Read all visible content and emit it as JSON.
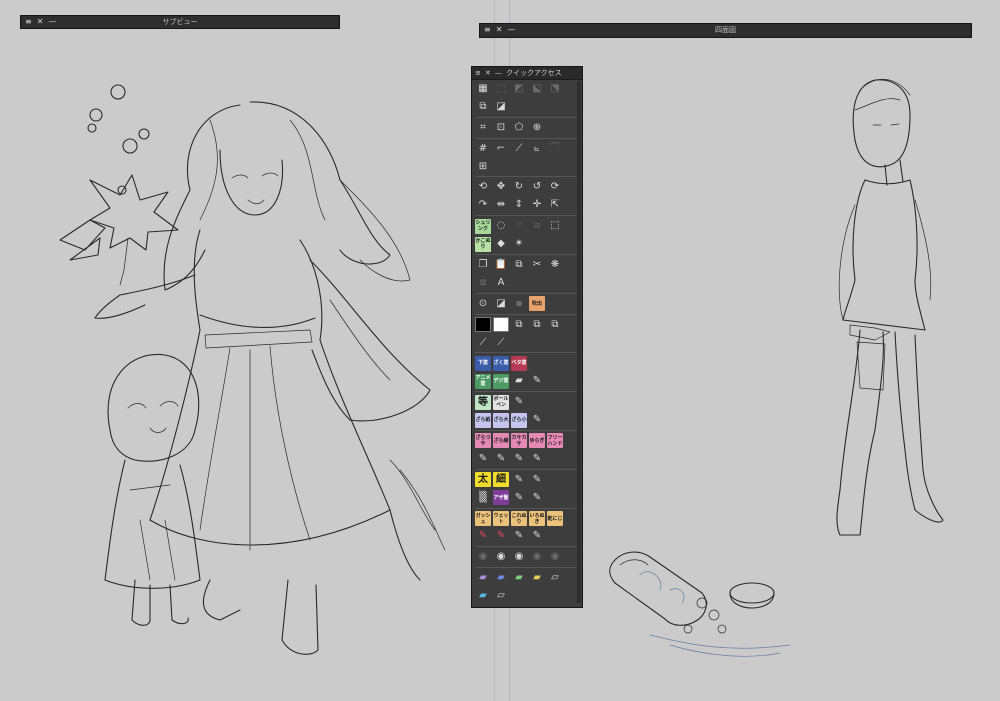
{
  "subview": {
    "title": "サブビュー",
    "close": "✕",
    "menu": "≡",
    "min": "—"
  },
  "threeview": {
    "title": "四面図",
    "close": "✕",
    "menu": "≡",
    "min": "—"
  },
  "quick_access": {
    "title": "クイックアクセス",
    "close": "✕",
    "menu": "≡",
    "min": "—",
    "rows": [
      [
        {
          "n": "select-all-icon",
          "g": "▦"
        },
        {
          "n": "deselect-icon",
          "g": "⬚",
          "d": true
        },
        {
          "n": "invert-icon",
          "g": "◩",
          "d": true
        },
        {
          "n": "expand-icon",
          "g": "⬕",
          "d": true
        },
        {
          "n": "shrink-icon",
          "g": "⬔",
          "d": true
        }
      ],
      [
        {
          "n": "new-layer-icon",
          "g": "⧉"
        },
        {
          "n": "layer-mask-icon",
          "g": "◪"
        }
      ],
      [
        {
          "n": "crop-icon",
          "g": "⌗",
          "sep": true
        },
        {
          "n": "free-transform-icon",
          "g": "⊡"
        },
        {
          "n": "distort-icon",
          "g": "⬠"
        },
        {
          "n": "mesh-icon",
          "g": "⊕"
        }
      ],
      [
        {
          "n": "grid-icon",
          "g": "#",
          "sep": true
        },
        {
          "n": "ruler-icon",
          "g": "⌐"
        },
        {
          "n": "pen-ruler-icon",
          "g": "⟋"
        },
        {
          "n": "linear-ruler-icon",
          "g": "⦜"
        },
        {
          "n": "curve-ruler-icon",
          "g": "⌒",
          "d": true
        }
      ],
      [
        {
          "n": "perspective-icon",
          "g": "⊞"
        }
      ],
      [
        {
          "n": "rotate-left-icon",
          "g": "⟲",
          "sep": true
        },
        {
          "n": "move-icon",
          "g": "✥"
        },
        {
          "n": "rotate-view-icon",
          "g": "↻"
        },
        {
          "n": "rotate-ccw-icon",
          "g": "↺"
        },
        {
          "n": "rotate-reset-icon",
          "g": "⟳"
        }
      ],
      [
        {
          "n": "rotate-right-icon",
          "g": "↷"
        },
        {
          "n": "flip-h-icon",
          "g": "⇹"
        },
        {
          "n": "flip-v-icon",
          "g": "⇕"
        },
        {
          "n": "pan-icon",
          "g": "✛"
        },
        {
          "n": "select-arrow-icon",
          "g": "⇱"
        }
      ],
      [
        {
          "n": "shrink-select-button",
          "t": "シュリンク",
          "c": "#a7d89a",
          "sep": true
        },
        {
          "n": "lasso-icon",
          "g": "◌"
        },
        {
          "n": "hand-icon",
          "g": "☞",
          "d": true
        },
        {
          "n": "no-fill-icon",
          "g": "⧄",
          "d": true
        },
        {
          "n": "rect-select-icon",
          "g": "⬚"
        }
      ],
      [
        {
          "n": "fill-enclose-button",
          "t": "かこぬり",
          "c": "#b8e1a6"
        },
        {
          "n": "fill-bucket-icon",
          "g": "◆"
        },
        {
          "n": "magic-wand-icon",
          "g": "✶"
        }
      ],
      [
        {
          "n": "copy-icon",
          "g": "❐",
          "sep": true
        },
        {
          "n": "paste-icon",
          "g": "📋"
        },
        {
          "n": "duplicate-icon",
          "g": "⧉"
        },
        {
          "n": "cut-icon",
          "g": "✂"
        },
        {
          "n": "loading-icon",
          "g": "❋"
        }
      ],
      [
        {
          "n": "merge-icon",
          "g": "⧈",
          "d": true
        },
        {
          "n": "text-icon",
          "g": "A"
        }
      ],
      [
        {
          "n": "zoom-icon",
          "g": "⊙",
          "sep": true
        },
        {
          "n": "frame-icon",
          "g": "◪"
        },
        {
          "n": "layer-dark-icon",
          "g": "▪",
          "d": true
        },
        {
          "n": "balloon-button",
          "t": "吹出",
          "c": "#e8a36d"
        }
      ],
      [
        {
          "n": "main-color-swatch",
          "sw": "#000000",
          "sep": true
        },
        {
          "n": "sub-color-swatch",
          "sw": "#ffffff"
        },
        {
          "n": "layer-stack-icon",
          "g": "⧉"
        },
        {
          "n": "layer-props-icon",
          "g": "⧉"
        },
        {
          "n": "layer-link-icon",
          "g": "⧉"
        }
      ],
      [
        {
          "n": "eyedropper-icon",
          "g": "⟋"
        },
        {
          "n": "eyedropper-2-icon",
          "g": "⟋"
        }
      ],
      [
        {
          "n": "shita-nuri-button",
          "t": "下塗",
          "c": "#3b5ca8",
          "w": true,
          "sep": true
        },
        {
          "n": "zakku-nuri-button",
          "t": "ざく塗",
          "c": "#3b5ca8",
          "w": true
        },
        {
          "n": "beta-nuri-button",
          "t": "ベタ塗",
          "c": "#b73a55",
          "w": true
        }
      ],
      [
        {
          "n": "anime-nuri-button",
          "t": "アニメ塗",
          "c": "#4c9a64",
          "w": true
        },
        {
          "n": "digital-nuri-button",
          "t": "デジ塗",
          "c": "#4c9a64",
          "w": true
        },
        {
          "n": "marker-icon",
          "g": "▰"
        },
        {
          "n": "pen-icon",
          "g": "✎"
        }
      ],
      [
        {
          "n": "tou-button",
          "t": "等",
          "c": "#bfe5c6",
          "big": true,
          "sep": true
        },
        {
          "n": "ballpen-button",
          "t": "ボールペン",
          "c": "#e2e2e2"
        },
        {
          "n": "pen-tool-icon",
          "g": "✎"
        }
      ],
      [
        {
          "n": "zara-1-button",
          "t": "ざら紙",
          "c": "#c5c5f0"
        },
        {
          "n": "zara-2-button",
          "t": "ざら大",
          "c": "#c5c5f0"
        },
        {
          "n": "zara-3-button",
          "t": "ざら小",
          "c": "#c5c5f0"
        },
        {
          "n": "pencil-icon",
          "g": "✎"
        }
      ],
      [
        {
          "n": "zara-tsuya-button",
          "t": "ざらつや",
          "c": "#e589b5",
          "sep": true
        },
        {
          "n": "zara-sen-button",
          "t": "ざら線",
          "c": "#e589b5"
        },
        {
          "n": "kasa-button",
          "t": "カサカサ",
          "c": "#e589b5"
        },
        {
          "n": "yura-button",
          "t": "ゆらぎ",
          "c": "#e589b5"
        },
        {
          "n": "free-button",
          "t": "フリーハンド",
          "c": "#e589b5"
        }
      ],
      [
        {
          "n": "brush-1-icon",
          "g": "✎"
        },
        {
          "n": "brush-2-icon",
          "g": "✎"
        },
        {
          "n": "brush-3-icon",
          "g": "✎"
        },
        {
          "n": "brush-4-icon",
          "g": "✎"
        }
      ],
      [
        {
          "n": "futo-button",
          "t": "太",
          "c": "#f1dc2e",
          "big": true,
          "sep": true
        },
        {
          "n": "hoso-button",
          "t": "細",
          "c": "#f1dc2e",
          "big": true
        },
        {
          "n": "ink-brush-icon",
          "g": "✎"
        },
        {
          "n": "brush-tip-icon",
          "g": "✎"
        }
      ],
      [
        {
          "n": "tone-black-icon",
          "g": "▒"
        },
        {
          "n": "aza-button",
          "t": "アザ髪",
          "c": "#7e3d99",
          "w": true
        },
        {
          "n": "smudge-icon",
          "g": "✎"
        },
        {
          "n": "blend-icon",
          "g": "✎"
        }
      ],
      [
        {
          "n": "gouache-button",
          "t": "ガッシュ",
          "c": "#ecc27a",
          "sep": true
        },
        {
          "n": "wet-button",
          "t": "ウェット",
          "c": "#ecc27a"
        },
        {
          "n": "kore-button",
          "t": "これぬり",
          "c": "#ecc27a"
        },
        {
          "n": "iroiro-button",
          "t": "いろぬき",
          "c": "#ecc27a"
        },
        {
          "n": "kawaki-button",
          "t": "乾にじ",
          "c": "#ecc27a"
        }
      ],
      [
        {
          "n": "red-brush-icon",
          "g": "✎",
          "red": true
        },
        {
          "n": "red-brush-2-icon",
          "g": "✎",
          "red": true
        },
        {
          "n": "airbrush-icon",
          "g": "✎"
        },
        {
          "n": "spray-icon",
          "g": "✎"
        }
      ],
      [
        {
          "n": "circle-1-icon",
          "g": "◉",
          "d": true,
          "sep": true
        },
        {
          "n": "circle-2-icon",
          "g": "◉"
        },
        {
          "n": "circle-3-icon",
          "g": "◉"
        },
        {
          "n": "circle-4-icon",
          "g": "◉",
          "d": true
        },
        {
          "n": "circle-5-icon",
          "g": "◉",
          "d": true
        }
      ],
      [
        {
          "n": "folder-purple-icon",
          "g": "▰",
          "fc": "#a78fd8",
          "sep": true
        },
        {
          "n": "folder-blue-icon",
          "g": "▰",
          "fc": "#6f8be0"
        },
        {
          "n": "folder-green-icon",
          "g": "▰",
          "fc": "#7fcf7f"
        },
        {
          "n": "folder-yellow-icon",
          "g": "▰",
          "fc": "#e6d05a"
        },
        {
          "n": "folder-white-icon",
          "g": "▱"
        }
      ],
      [
        {
          "n": "folder-cyan-icon",
          "g": "▰",
          "fc": "#57b9e3"
        },
        {
          "n": "open-folder-icon",
          "g": "▱"
        }
      ]
    ]
  }
}
